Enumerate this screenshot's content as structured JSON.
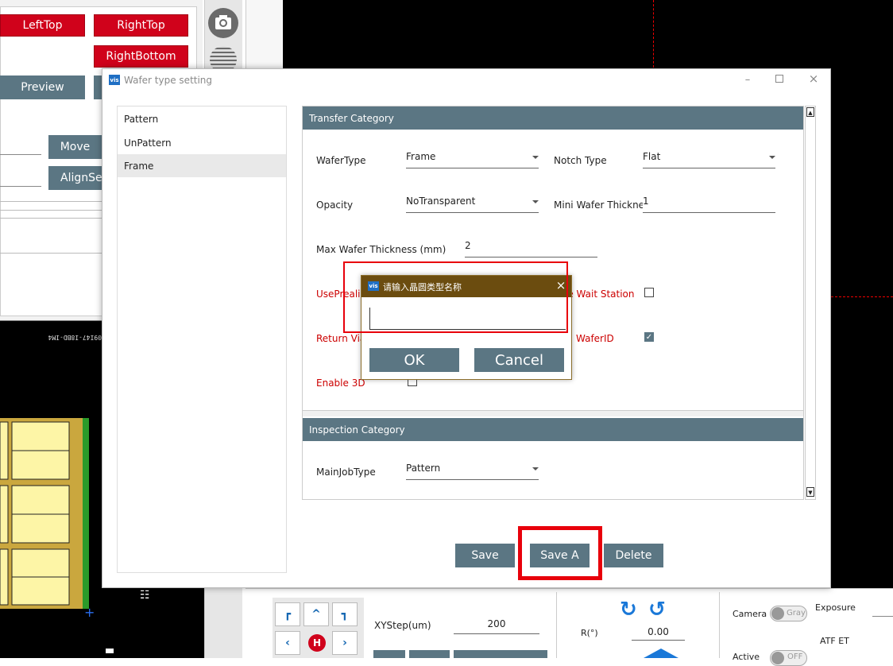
{
  "bg": {
    "btn_lefttop": "LeftTop",
    "btn_righttop": "RightTop",
    "btn_rightbottom": "RightBottom",
    "btn_preview": "Preview",
    "btn_move": "Move",
    "btn_alignset": "AlignSet",
    "wafer_label": "09I47-I8BD-IM4"
  },
  "dialog": {
    "title": "Wafer type setting",
    "list": [
      "Pattern",
      "UnPattern",
      "Frame"
    ],
    "transfer": {
      "header": "Transfer Category",
      "wafertype_label": "WaferType",
      "wafertype_value": "Frame",
      "notch_label": "Notch Type",
      "notch_value": "Flat",
      "opacity_label": "Opacity",
      "opacity_value": "NoTransparent",
      "mini_label": "Mini Wafer Thickness",
      "mini_value": "1",
      "max_label": "Max Wafer Thickness (mm)",
      "max_value": "2",
      "useprealign_label": "UsePrealig",
      "wait_label": "le Wait Station",
      "return_label": "Return Via",
      "waferid_label": "WaferID",
      "enable3d_label": "Enable 3D"
    },
    "inspection": {
      "header": "Inspection Category",
      "mainjob_label": "MainJobType",
      "mainjob_value": "Pattern"
    },
    "buttons": {
      "save": "Save",
      "save_a": "Save A",
      "delete": "Delete"
    }
  },
  "prompt": {
    "title": "请输入晶圆类型名称",
    "input_value": "",
    "ok": "OK",
    "cancel": "Cancel"
  },
  "bottom": {
    "xystep_label": "XYStep(um)",
    "xystep_value": "200",
    "r_label": "R(°)",
    "r_value": "0.00",
    "camera_label": "Camera",
    "gray_label": "Gray",
    "exposure_label": "Exposure",
    "atf_label": "ATF ET",
    "active_label": "Active",
    "off_label": "OFF",
    "home_label": "H"
  },
  "colors": {
    "accent_red": "#d0021b",
    "header_gray": "#5b7683",
    "prompt_title": "#6b4c0f",
    "highlight": "#e8000b"
  }
}
